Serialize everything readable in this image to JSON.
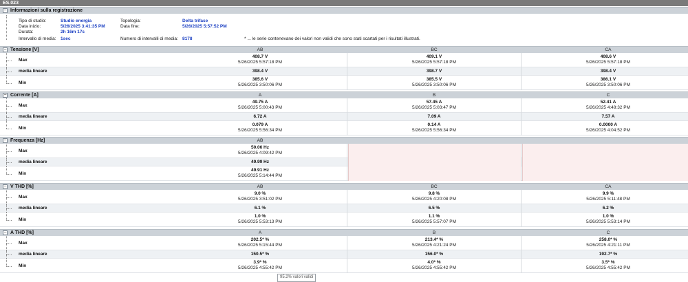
{
  "window": {
    "title": "ES.023"
  },
  "info": {
    "header": "Informazioni sulla registrazione",
    "study_type_label": "Tipo di studio:",
    "study_type_value": "Studio energia",
    "start_label": "Data inizio:",
    "start_value": "5/26/2025 3:41:35 PM",
    "duration_label": "Durata:",
    "duration_value": "2h 16m 17s",
    "interval_label": "Intervallo di media:",
    "interval_value": "1sec",
    "topology_label": "Topologia:",
    "topology_value": "Delta trifase",
    "end_label": "Data fine:",
    "end_value": "5/26/2025 5:57:52 PM",
    "num_intervals_label": "Numero di intervalli di media:",
    "num_intervals_value": "8178",
    "note": "* ... le serie contenevano dei valori non validi che sono stati scartati per i risultati illustrati."
  },
  "sections": [
    {
      "title": "Tensione [V]",
      "cols": [
        "AB",
        "BC",
        "CA"
      ],
      "rows": [
        {
          "label": "Max",
          "cells": [
            {
              "v": "408.7 V",
              "t": "5/26/2025 5:57:18 PM"
            },
            {
              "v": "409.1 V",
              "t": "5/26/2025 5:57:18 PM"
            },
            {
              "v": "408.6 V",
              "t": "5/26/2025 5:57:18 PM"
            }
          ]
        },
        {
          "label": "media lineare",
          "cells": [
            {
              "v": "398.4 V"
            },
            {
              "v": "398.7 V"
            },
            {
              "v": "398.4 V"
            }
          ]
        },
        {
          "label": "Min",
          "cells": [
            {
              "v": "385.6 V",
              "t": "5/26/2025 3:50:06 PM"
            },
            {
              "v": "385.5 V",
              "t": "5/26/2025 3:50:06 PM"
            },
            {
              "v": "386.1 V",
              "t": "5/26/2025 3:50:06 PM"
            }
          ]
        }
      ]
    },
    {
      "title": "Corrente [A]",
      "cols": [
        "A",
        "B",
        "C"
      ],
      "rows": [
        {
          "label": "Max",
          "cells": [
            {
              "v": "49.75 A",
              "t": "5/26/2025 5:00:43 PM"
            },
            {
              "v": "57.45 A",
              "t": "5/26/2025 5:03:47 PM"
            },
            {
              "v": "52.41 A",
              "t": "5/26/2025 4:48:32 PM"
            }
          ]
        },
        {
          "label": "media lineare",
          "cells": [
            {
              "v": "6.72 A"
            },
            {
              "v": "7.09 A"
            },
            {
              "v": "7.57 A"
            }
          ]
        },
        {
          "label": "Min",
          "cells": [
            {
              "v": "0.079 A",
              "t": "5/26/2025 5:56:34 PM"
            },
            {
              "v": "0.14 A",
              "t": "5/26/2025 5:56:34 PM"
            },
            {
              "v": "0.0000 A",
              "t": "5/26/2025 4:04:52 PM"
            }
          ]
        }
      ]
    },
    {
      "title": "Frequenza [Hz]",
      "cols": [
        "AB",
        "",
        ""
      ],
      "rows": [
        {
          "label": "Max",
          "cells": [
            {
              "v": "50.06 Hz",
              "t": "5/26/2025 4:09:42 PM"
            }
          ]
        },
        {
          "label": "media lineare",
          "cells": [
            {
              "v": "49.99 Hz"
            }
          ]
        },
        {
          "label": "Min",
          "cells": [
            {
              "v": "49.91 Hz",
              "t": "5/26/2025 5:14:44 PM"
            }
          ]
        }
      ]
    },
    {
      "title": "V THD [%]",
      "cols": [
        "AB",
        "BC",
        "CA"
      ],
      "rows": [
        {
          "label": "Max",
          "cells": [
            {
              "v": "9.0 %",
              "t": "5/26/2025 3:51:02 PM"
            },
            {
              "v": "9.8 %",
              "t": "5/26/2025 4:20:08 PM"
            },
            {
              "v": "9.9 %",
              "t": "5/26/2025 5:11:48 PM"
            }
          ]
        },
        {
          "label": "media lineare",
          "cells": [
            {
              "v": "6.1 %"
            },
            {
              "v": "6.5 %"
            },
            {
              "v": "6.2 %"
            }
          ]
        },
        {
          "label": "Min",
          "cells": [
            {
              "v": "1.0 %",
              "t": "5/26/2025 5:53:13 PM"
            },
            {
              "v": "1.1 %",
              "t": "5/26/2025 5:57:07 PM"
            },
            {
              "v": "1.0 %",
              "t": "5/26/2025 5:53:14 PM"
            }
          ]
        }
      ]
    },
    {
      "title": "A THD [%]",
      "cols": [
        "A",
        "B",
        "C"
      ],
      "rows": [
        {
          "label": "Max",
          "cells": [
            {
              "v": "202.5* %",
              "t": "5/26/2025 5:15:44 PM"
            },
            {
              "v": "213.4* %",
              "t": "5/26/2025 4:21:24 PM"
            },
            {
              "v": "258.0* %",
              "t": "5/26/2025 4:21:11 PM"
            }
          ]
        },
        {
          "label": "media lineare",
          "cells": [
            {
              "v": "150.5* %"
            },
            {
              "v": "156.0* %"
            },
            {
              "v": "192.7* %"
            }
          ]
        },
        {
          "label": "Min",
          "cells": [
            {
              "v": "3.9* %",
              "t": "5/26/2025 4:55:42 PM"
            },
            {
              "v": "4.0* %",
              "t": "5/26/2025 4:55:42 PM"
            },
            {
              "v": "3.5* %",
              "t": "5/26/2025 4:55:42 PM"
            }
          ]
        }
      ]
    }
  ],
  "tooltip": "95.2% valori validi"
}
